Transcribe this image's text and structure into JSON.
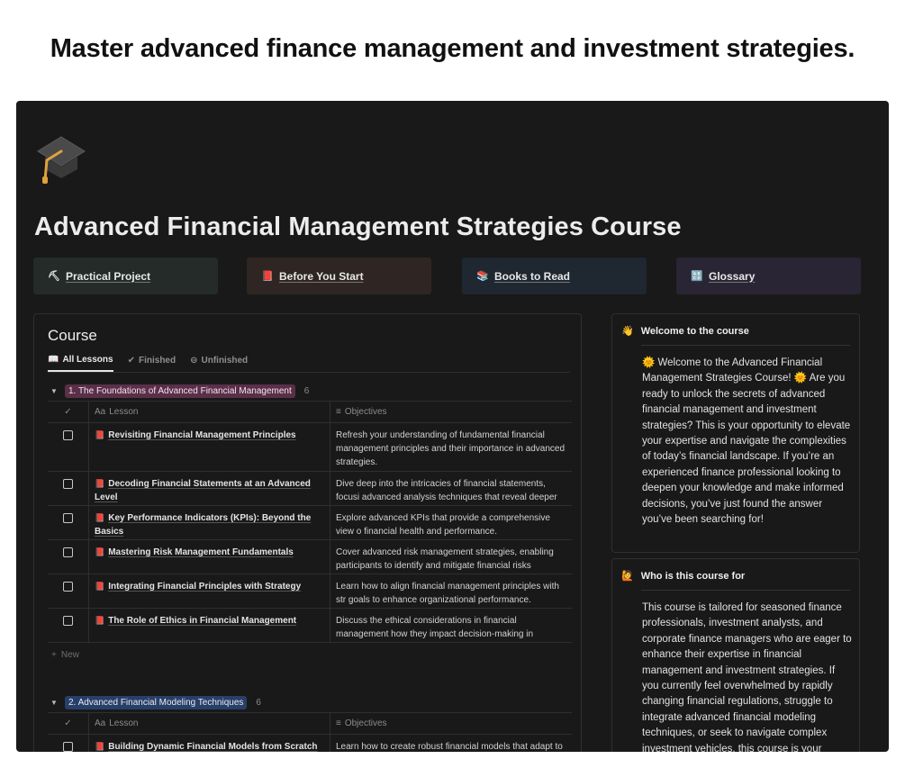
{
  "headline": "Master advanced finance management and investment strategies.",
  "page": {
    "icon": "graduation-cap-icon",
    "title": "Advanced Financial Management Strategies Course"
  },
  "callouts": [
    {
      "icon": "pickaxe-icon",
      "glyph": "⛏",
      "label": "Practical Project"
    },
    {
      "icon": "red-book-icon",
      "glyph": "📕",
      "label": "Before You Start"
    },
    {
      "icon": "books-icon",
      "glyph": "📚",
      "label": "Books to Read"
    },
    {
      "icon": "abcd-icon",
      "glyph": "🔠",
      "label": "Glossary"
    }
  ],
  "course": {
    "title": "Course",
    "views": [
      {
        "icon": "book-icon",
        "glyph": "📖",
        "label": "All Lessons"
      },
      {
        "icon": "check-circle-icon",
        "glyph": "✔",
        "label": "Finished"
      },
      {
        "icon": "minus-circle-icon",
        "glyph": "⊖",
        "label": "Unfinished"
      }
    ],
    "columns": {
      "lesson": "Lesson",
      "lesson_prefix": "Aa",
      "objectives": "Objectives"
    },
    "new_label": "New",
    "groups": [
      {
        "name": "1. The Foundations of Advanced Financial Management",
        "count": "6",
        "color": "#5b2f48",
        "rows": [
          {
            "lesson": "Revisiting Financial Management Principles",
            "objectives": "Refresh your understanding of fundamental financial management principles and their importance in advanced strategies."
          },
          {
            "lesson": "Decoding Financial Statements at an Advanced Level",
            "objectives": "Dive deep into the intricacies of financial statements, focusi advanced analysis techniques that reveal deeper insights."
          },
          {
            "lesson": "Key Performance Indicators (KPIs): Beyond the Basics",
            "objectives": "Explore advanced KPIs that provide a comprehensive view o financial health and performance."
          },
          {
            "lesson": "Mastering Risk Management Fundamentals",
            "objectives": "Cover advanced risk management strategies, enabling participants to identify and mitigate financial risks effectivel"
          },
          {
            "lesson": "Integrating Financial Principles with Strategy",
            "objectives": "Learn how to align financial management principles with str goals to enhance organizational performance."
          },
          {
            "lesson": "The Role of Ethics in Financial Management",
            "objectives": "Discuss the ethical considerations in financial management how they impact decision-making in advanced practices."
          }
        ]
      },
      {
        "name": "2. Advanced Financial Modeling Techniques",
        "count": "6",
        "color": "#26406a",
        "rows": [
          {
            "lesson": "Building Dynamic Financial Models from Scratch",
            "objectives": "Learn how to create robust financial models that adapt to"
          }
        ]
      }
    ]
  },
  "sidebar": {
    "welcome": {
      "icon": "waving-hand-icon",
      "glyph": "👋",
      "title": "Welcome to the course",
      "body": "🌞 Welcome to the Advanced Financial Management Strategies Course! 🌞 Are you ready to unlock the secrets of advanced financial management and investment strategies? This is your opportunity to elevate your expertise and navigate the complexities of today’s financial landscape. If you’re an experienced finance professional looking to deepen your knowledge and make informed decisions, you’ve just found the answer you’ve been searching for!"
    },
    "who": {
      "icon": "raised-hand-icon",
      "glyph": "🙋",
      "title": "Who is this course for",
      "body": "This course is tailored for seasoned finance professionals, investment analysts, and corporate finance managers who are eager to enhance their expertise in financial management and investment strategies. If you currently feel overwhelmed by rapidly changing financial regulations, struggle to integrate advanced financial modeling techniques, or seek to navigate complex investment vehicles, this course is your"
    }
  }
}
